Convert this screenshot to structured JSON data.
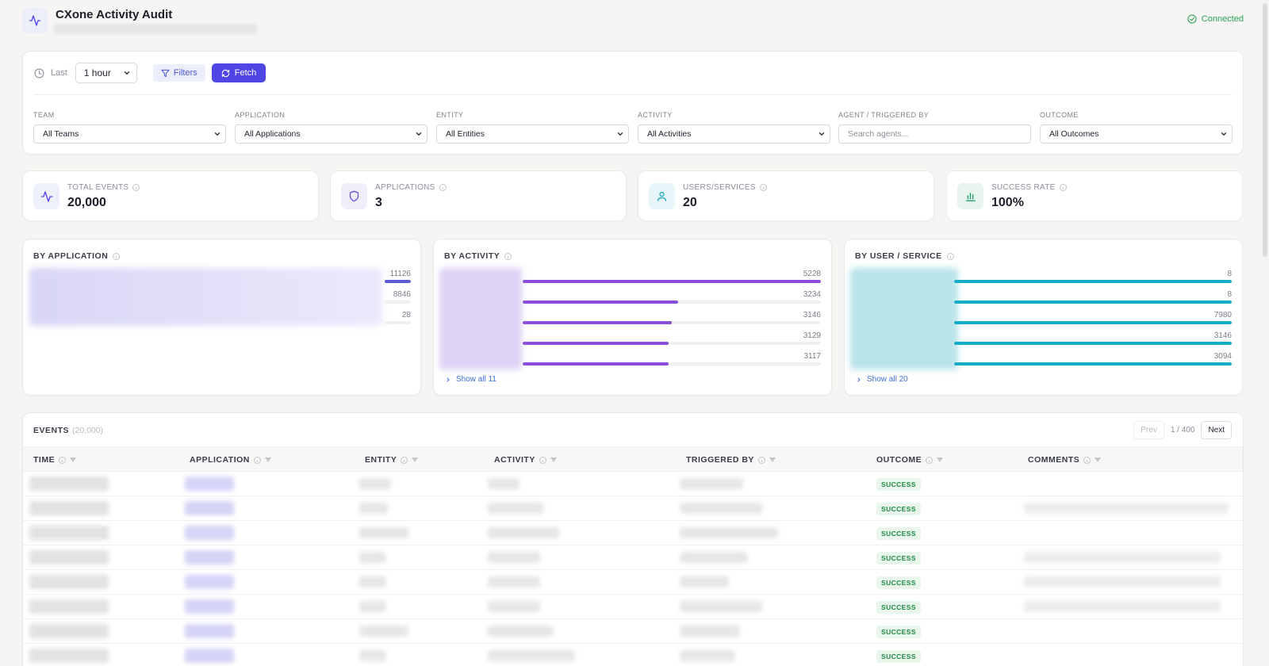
{
  "header": {
    "title": "CXone Activity Audit",
    "status": "Connected",
    "icons": {
      "app": "activity-pulse-icon",
      "status": "check-circle-icon"
    }
  },
  "toolbar": {
    "last_label": "Last",
    "range_value": "1 hour",
    "filters_label": "Filters",
    "fetch_label": "Fetch"
  },
  "filters": [
    {
      "label": "Team",
      "value": "All Teams",
      "type": "select"
    },
    {
      "label": "Application",
      "value": "All Applications",
      "type": "select"
    },
    {
      "label": "Entity",
      "value": "All Entities",
      "type": "select"
    },
    {
      "label": "Activity",
      "value": "All Activities",
      "type": "select"
    },
    {
      "label": "Agent / Triggered By",
      "placeholder": "Search agents...",
      "type": "input"
    },
    {
      "label": "Outcome",
      "value": "All Outcomes",
      "type": "select"
    }
  ],
  "stats": [
    {
      "label": "Total Events",
      "value": "20,000",
      "icon": "activity-icon",
      "color": "#4f46e5",
      "bg": "#eef0fb"
    },
    {
      "label": "Applications",
      "value": "3",
      "icon": "shield-icon",
      "color": "#6b4fd8",
      "bg": "#f1eefb"
    },
    {
      "label": "Users/Services",
      "value": "20",
      "icon": "user-icon",
      "color": "#14a3b8",
      "bg": "#e7f6f8"
    },
    {
      "label": "Success Rate",
      "value": "100%",
      "icon": "bar-chart-icon",
      "color": "#22a06b",
      "bg": "#e7f5ee"
    }
  ],
  "breakdowns": {
    "by_application": {
      "title": "BY APPLICATION",
      "color": "#5b5bd6",
      "rows": [
        {
          "count": "11126",
          "fraction": 1.0
        },
        {
          "count": "8846",
          "fraction": 0.0
        },
        {
          "count": "28",
          "fraction": 0.0
        }
      ]
    },
    "by_activity": {
      "title": "BY ACTIVITY",
      "color": "#8a4fd8",
      "show_all": "Show all 11",
      "rows": [
        {
          "count": "5228",
          "fraction": 1.0
        },
        {
          "count": "3234",
          "fraction": 0.52
        },
        {
          "count": "3146",
          "fraction": 0.5
        },
        {
          "count": "3129",
          "fraction": 0.49
        },
        {
          "count": "3117",
          "fraction": 0.49
        }
      ]
    },
    "by_user_service": {
      "title": "BY USER / SERVICE",
      "color": "#14acc8",
      "show_all": "Show all 20",
      "rows": [
        {
          "count": "8",
          "fraction": 1.0
        },
        {
          "count": "8",
          "fraction": 1.0
        },
        {
          "count": "7980",
          "fraction": 1.0
        },
        {
          "count": "3146",
          "fraction": 1.0
        },
        {
          "count": "3094",
          "fraction": 1.0
        }
      ]
    }
  },
  "events": {
    "title": "EVENTS",
    "count": "(20,000)",
    "prev_label": "Prev",
    "page_info": "1 / 400",
    "next_label": "Next",
    "columns": [
      "TIME",
      "APPLICATION",
      "ENTITY",
      "ACTIVITY",
      "TRIGGERED BY",
      "OUTCOME",
      "COMMENTS"
    ],
    "outcomes": [
      "SUCCESS",
      "SUCCESS",
      "SUCCESS",
      "SUCCESS",
      "SUCCESS",
      "SUCCESS",
      "SUCCESS",
      "SUCCESS"
    ]
  }
}
